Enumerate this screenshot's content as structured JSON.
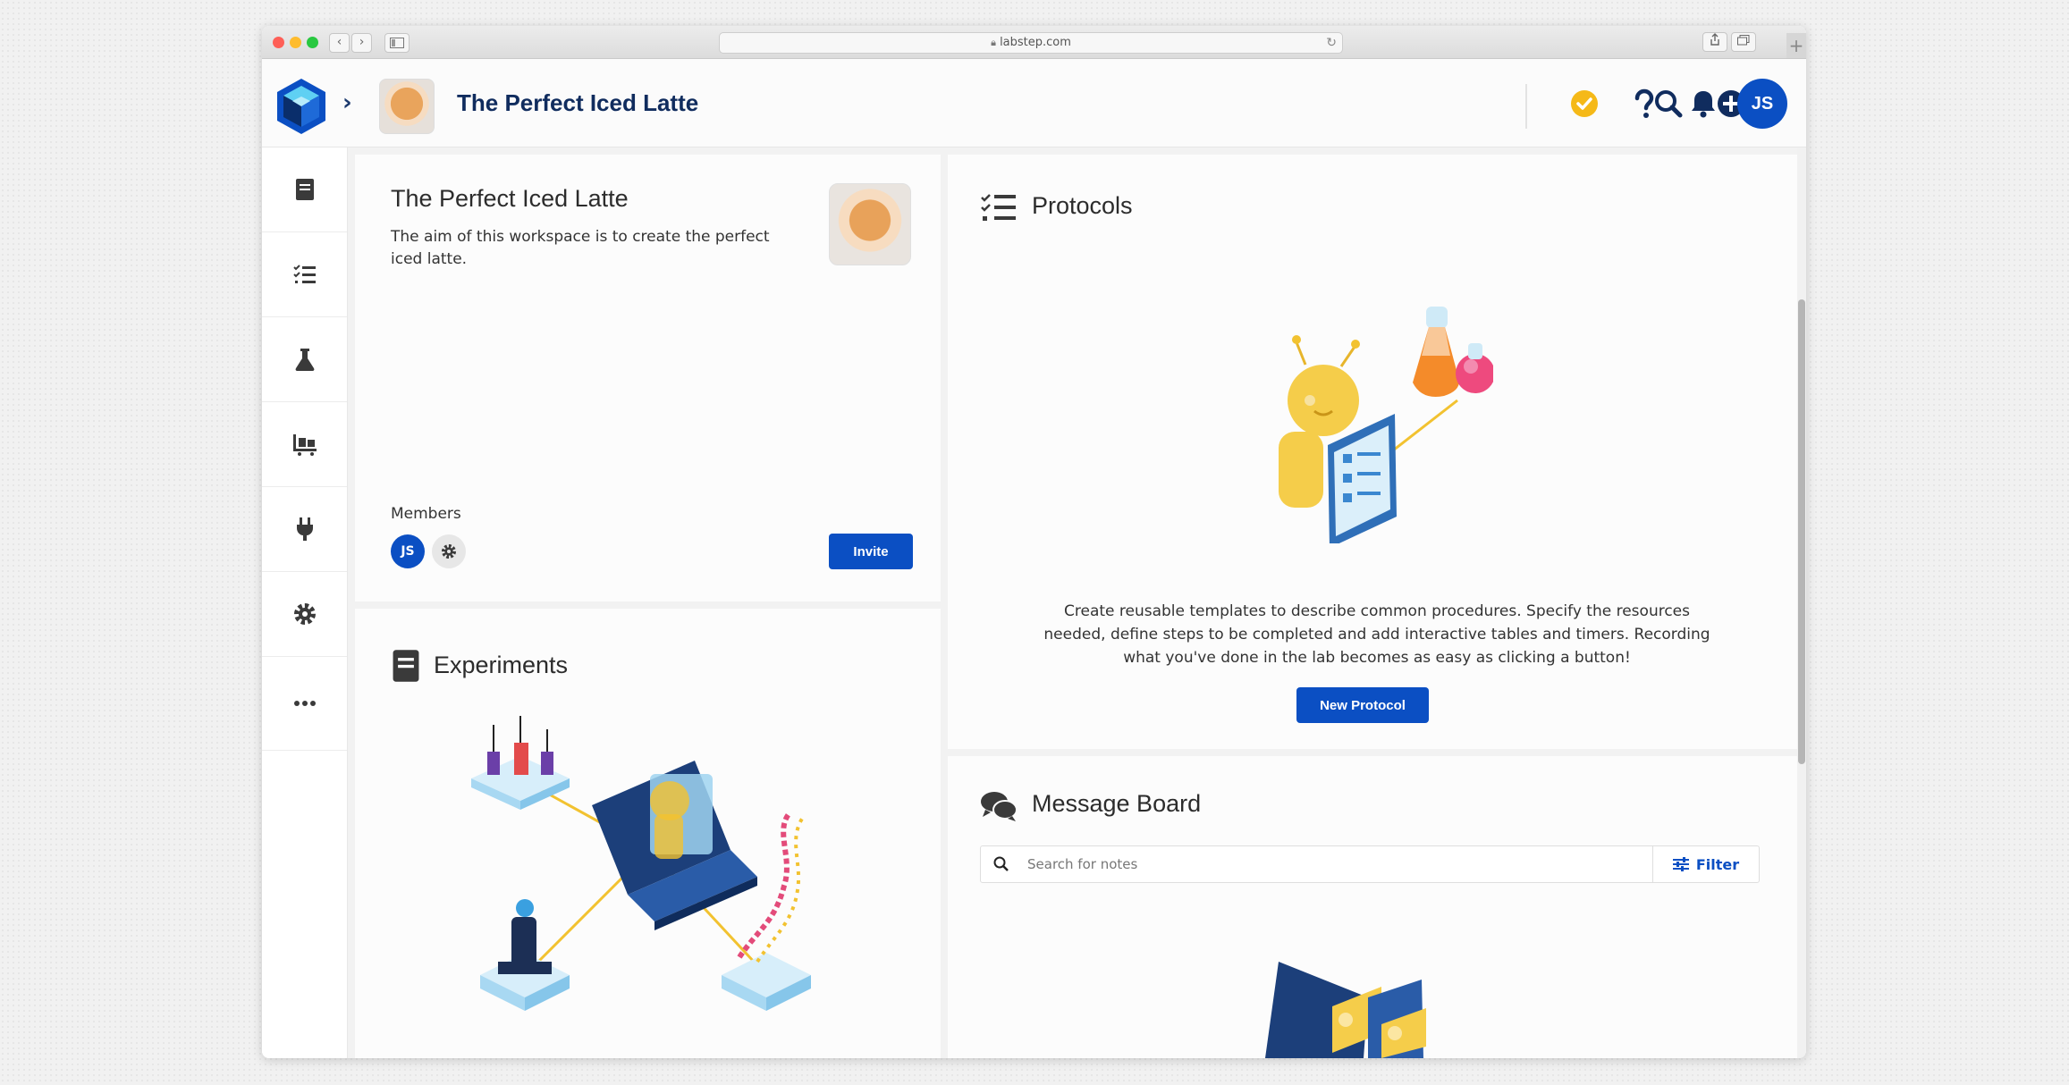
{
  "browser": {
    "url": "labstep.com"
  },
  "header": {
    "title": "The Perfect Iced Latte",
    "user_initials": "JS"
  },
  "workspace": {
    "title": "The Perfect Iced Latte",
    "description": "The aim of this workspace is to create the perfect iced latte.",
    "members_label": "Members",
    "member_initials": "JS",
    "invite_label": "Invite"
  },
  "experiments": {
    "title": "Experiments"
  },
  "protocols": {
    "title": "Protocols",
    "description": "Create reusable templates to describe common procedures. Specify the resources needed, define steps to be completed and add interactive tables and timers. Recording what you've done in the lab becomes as easy as clicking a button!",
    "new_button_label": "New Protocol"
  },
  "message_board": {
    "title": "Message Board",
    "search_placeholder": "Search for notes",
    "filter_label": "Filter"
  },
  "colors": {
    "primary": "#0b4fc3",
    "navy": "#102c5e",
    "status": "#f5b918"
  }
}
